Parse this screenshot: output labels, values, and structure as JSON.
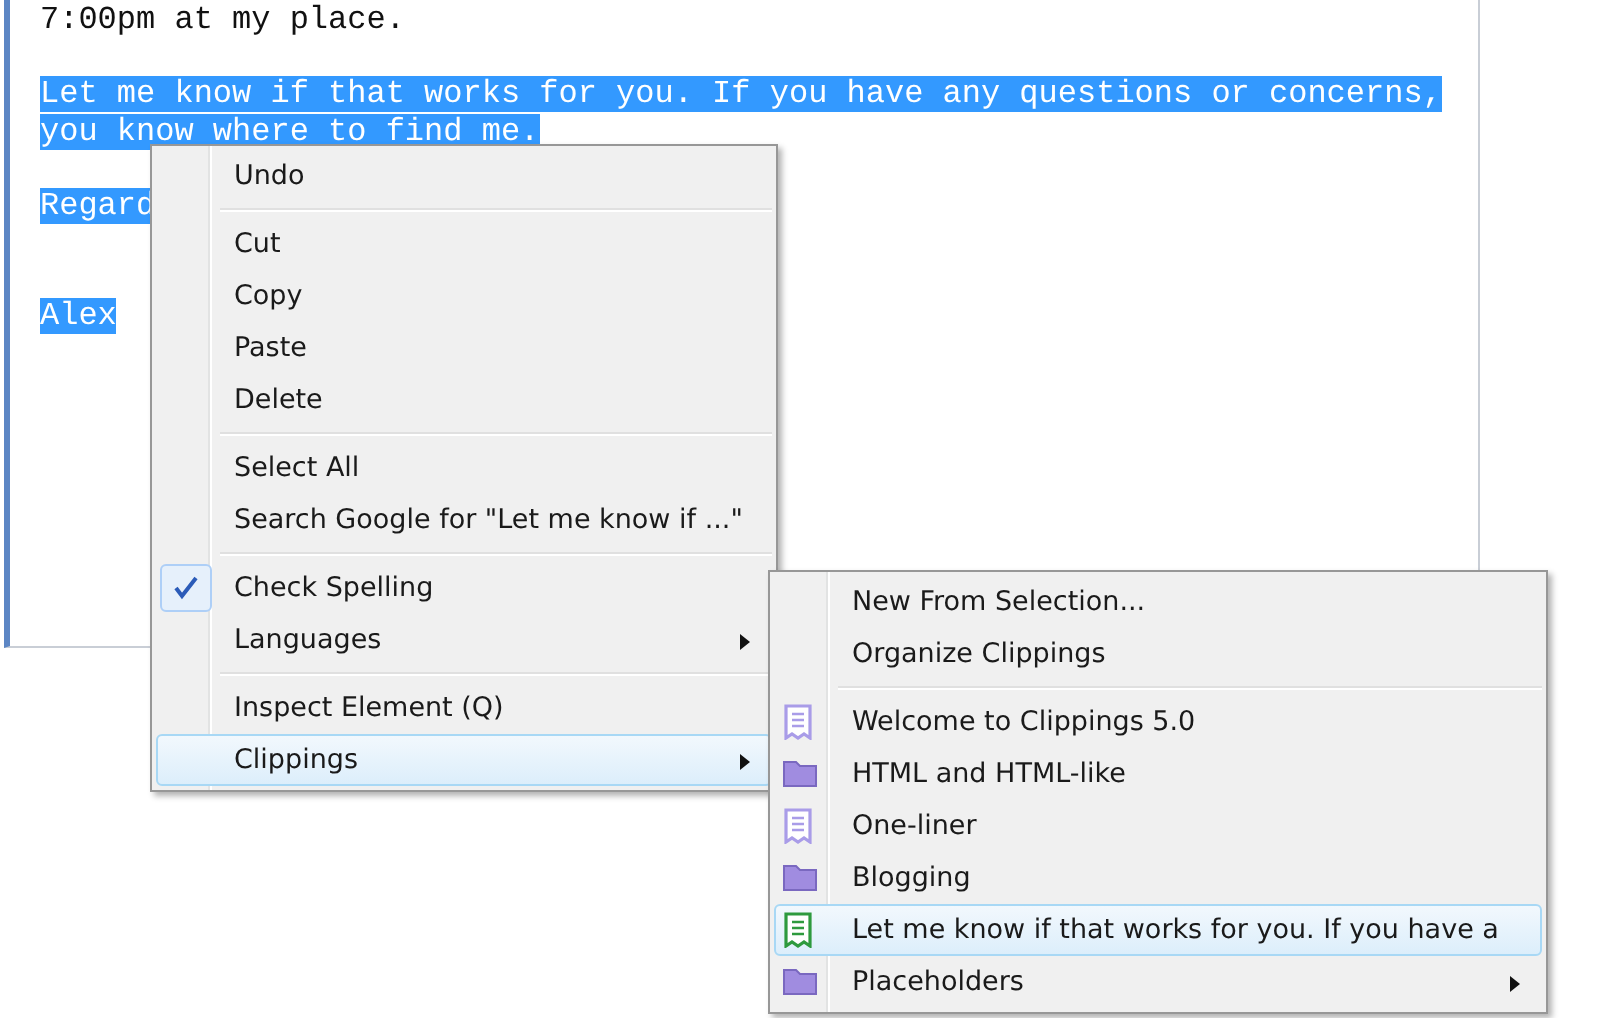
{
  "editor": {
    "paragraphs": [
      {
        "kind": "paragraph",
        "lines": [
          "7:00pm at my place."
        ],
        "selected": false
      },
      {
        "kind": "paragraph",
        "lines": [
          "Let me know if that works for you. If you have any questions or concerns,",
          "you know where to find me."
        ],
        "selected": true
      },
      {
        "kind": "paragraph",
        "lines": [
          "Regard"
        ],
        "selected": true
      },
      {
        "kind": "signature",
        "lines": [
          "Alex"
        ],
        "selected": true
      }
    ]
  },
  "context_menu": {
    "groups": [
      [
        {
          "label": "Undo",
          "kind": "command",
          "checked": false,
          "selected": false
        }
      ],
      [
        {
          "label": "Cut",
          "kind": "command",
          "checked": false,
          "selected": false
        },
        {
          "label": "Copy",
          "kind": "command",
          "checked": false,
          "selected": false
        },
        {
          "label": "Paste",
          "kind": "command",
          "checked": false,
          "selected": false
        },
        {
          "label": "Delete",
          "kind": "command",
          "checked": false,
          "selected": false
        }
      ],
      [
        {
          "label": "Select All",
          "kind": "command",
          "checked": false,
          "selected": false
        },
        {
          "label": "Search Google for \"Let me know if ...\"",
          "kind": "command",
          "checked": false,
          "selected": false
        }
      ],
      [
        {
          "label": "Check Spelling",
          "kind": "command",
          "checked": true,
          "selected": false
        },
        {
          "label": "Languages",
          "kind": "submenu",
          "checked": false,
          "selected": false
        }
      ],
      [
        {
          "label": "Inspect Element (Q)",
          "kind": "command",
          "checked": false,
          "selected": false
        },
        {
          "label": "Clippings",
          "kind": "submenu",
          "checked": false,
          "selected": true
        }
      ]
    ]
  },
  "clippings_menu": {
    "groups": [
      [
        {
          "label": "New From Selection...",
          "kind": "command",
          "selected": false
        },
        {
          "label": "Organize Clippings",
          "kind": "command",
          "selected": false
        }
      ],
      [
        {
          "label": "Welcome to Clippings 5.0",
          "kind": "clipping",
          "color": "#a99ce8",
          "selected": false
        },
        {
          "label": "HTML and HTML-like",
          "kind": "folder",
          "color": "#a08ce0",
          "selected": false
        },
        {
          "label": "One-liner",
          "kind": "clipping",
          "color": "#a99ce8",
          "selected": false
        },
        {
          "label": "Blogging",
          "kind": "folder",
          "color": "#a08ce0",
          "selected": false
        },
        {
          "label": "Let me know if that works for you. If you have a",
          "kind": "clipping",
          "color": "#2e9a3e",
          "selected": true
        },
        {
          "label": "Placeholders",
          "kind": "folder_submenu",
          "color": "#a08ce0",
          "selected": false
        }
      ]
    ]
  }
}
